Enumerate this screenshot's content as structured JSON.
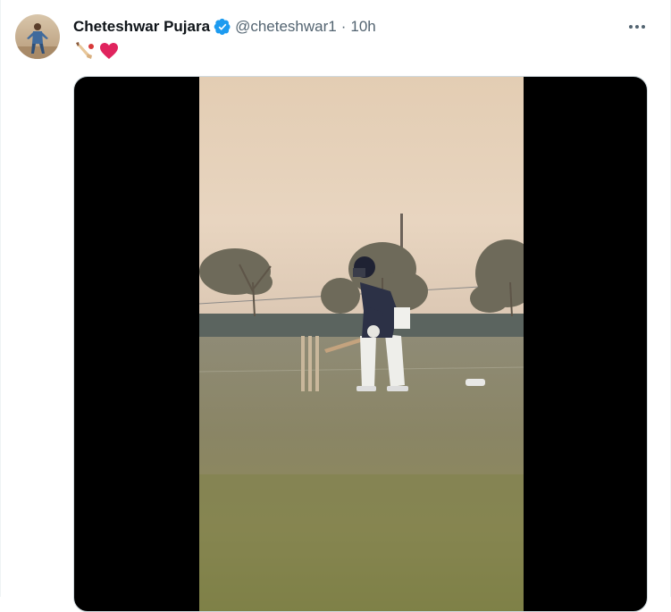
{
  "tweet": {
    "author": {
      "display_name": "Cheteshwar Pujara",
      "handle": "@cheteshwar1",
      "verified": true
    },
    "separator": "·",
    "timestamp": "10h",
    "text_emojis": [
      "cricket-bat-emoji",
      "red-heart-emoji"
    ],
    "media": {
      "type": "video",
      "scene": "cricket-practice-net"
    }
  },
  "colors": {
    "name": "#0f1419",
    "secondary": "#536471",
    "verified_badge": "#1d9bf0",
    "heart": "#e0245e",
    "video_letterbox": "#000000"
  },
  "icons": {
    "more": "more-horizontal-icon",
    "verified": "verified-badge-icon"
  }
}
